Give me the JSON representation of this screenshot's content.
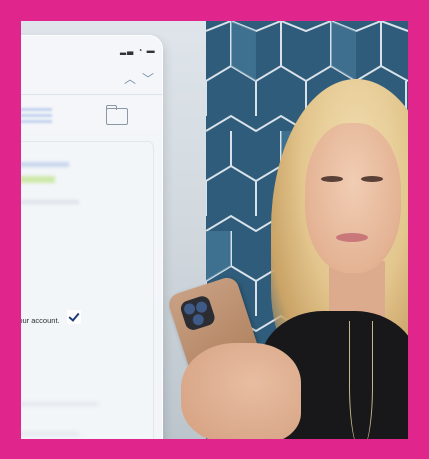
{
  "scene": {
    "frame_color": "#e0268c",
    "mockup": {
      "visible_text": "ify your account.",
      "icons": [
        "status-bar-icons",
        "chevron-up-icon",
        "chevron-down-icon",
        "folder-icon",
        "checkmark-icon"
      ],
      "status_icons_glyph": "▂▃ ◔ ▬",
      "chevron_up_glyph": "︿",
      "chevron_down_glyph": "﹀"
    }
  }
}
